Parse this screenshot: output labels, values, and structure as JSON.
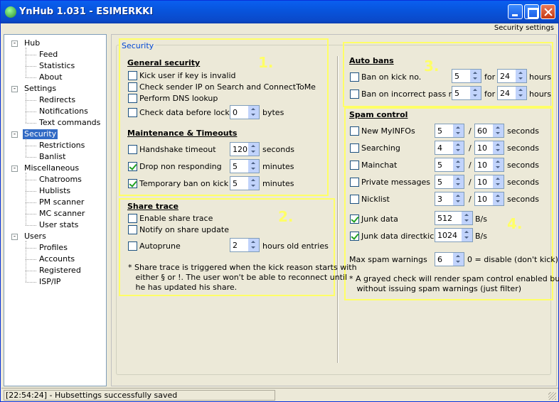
{
  "window": {
    "title": "YnHub 1.031 - ESIMERKKI",
    "header_right": "Security settings"
  },
  "tree": {
    "items": [
      {
        "label": "Hub",
        "level": 0,
        "expander": "-"
      },
      {
        "label": "Feed",
        "level": 1
      },
      {
        "label": "Statistics",
        "level": 1
      },
      {
        "label": "About",
        "level": 1
      },
      {
        "label": "Settings",
        "level": 0,
        "expander": "-"
      },
      {
        "label": "Redirects",
        "level": 1
      },
      {
        "label": "Notifications",
        "level": 1
      },
      {
        "label": "Text commands",
        "level": 1
      },
      {
        "label": "Security",
        "level": 0,
        "expander": "-",
        "selected": true
      },
      {
        "label": "Restrictions",
        "level": 1
      },
      {
        "label": "Banlist",
        "level": 1
      },
      {
        "label": "Miscellaneous",
        "level": 0,
        "expander": "-"
      },
      {
        "label": "Chatrooms",
        "level": 1
      },
      {
        "label": "Hublists",
        "level": 1
      },
      {
        "label": "PM scanner",
        "level": 1
      },
      {
        "label": "MC scanner",
        "level": 1
      },
      {
        "label": "User stats",
        "level": 1
      },
      {
        "label": "Users",
        "level": 0,
        "expander": "-"
      },
      {
        "label": "Profiles",
        "level": 1
      },
      {
        "label": "Accounts",
        "level": 1
      },
      {
        "label": "Registered",
        "level": 1
      },
      {
        "label": "ISP/IP",
        "level": 1
      }
    ]
  },
  "security": {
    "group_label": "Security",
    "general": {
      "heading": "General security",
      "kick_invalid_key": {
        "label": "Kick user if key is invalid",
        "checked": false
      },
      "check_sender_ip": {
        "label": "Check sender IP on Search and ConnectToMe",
        "checked": false
      },
      "dns_lookup": {
        "label": "Perform DNS lookup",
        "checked": false
      },
      "check_data_before_lock": {
        "label": "Check data before lock",
        "checked": false,
        "value": "0",
        "unit": "bytes"
      }
    },
    "maintenance": {
      "heading": "Maintenance & Timeouts",
      "handshake_timeout": {
        "label": "Handshake timeout",
        "checked": false,
        "value": "120",
        "unit": "seconds"
      },
      "drop_non_responding": {
        "label": "Drop non responding",
        "checked": true,
        "value": "5",
        "unit": "minutes"
      },
      "temp_ban_on_kick": {
        "label": "Temporary ban on kick",
        "checked": true,
        "value": "5",
        "unit": "minutes"
      }
    },
    "share_trace": {
      "heading": "Share trace",
      "enable": {
        "label": "Enable share trace",
        "checked": false
      },
      "notify": {
        "label": "Notify on share update",
        "checked": false
      },
      "autoprune": {
        "label": "Autoprune",
        "checked": false,
        "value": "2",
        "unit": "hours old entries"
      },
      "note": "* Share trace is triggered when the kick reason starts with\n   either § or !. The user won't be able to reconnect until\n   he has updated his share."
    },
    "auto_bans": {
      "heading": "Auto bans",
      "kick_no": {
        "label": "Ban on kick no.",
        "checked": false,
        "value": "5",
        "for": "for",
        "hours_value": "24",
        "unit": "hours"
      },
      "incorrect_pass": {
        "label": "Ban on incorrect pass no.",
        "checked": false,
        "value": "5",
        "for": "for",
        "hours_value": "24",
        "unit": "hours"
      }
    },
    "spam": {
      "heading": "Spam control",
      "rows": [
        {
          "label": "New MyINFOs",
          "checked": false,
          "a": "5",
          "b": "60",
          "unit": "seconds"
        },
        {
          "label": "Searching",
          "checked": false,
          "a": "4",
          "b": "10",
          "unit": "seconds"
        },
        {
          "label": "Mainchat",
          "checked": false,
          "a": "5",
          "b": "10",
          "unit": "seconds"
        },
        {
          "label": "Private messages",
          "checked": false,
          "a": "5",
          "b": "10",
          "unit": "seconds"
        },
        {
          "label": "Nicklist",
          "checked": false,
          "a": "3",
          "b": "10",
          "unit": "seconds"
        }
      ],
      "slash": "/",
      "junk_data": {
        "label": "Junk data",
        "checked": true,
        "value": "512",
        "unit": "B/s"
      },
      "junk_directkick": {
        "label": "Junk data directkick",
        "checked": true,
        "value": "1024",
        "unit": "B/s"
      },
      "max_warnings": {
        "label": "Max spam warnings",
        "value": "6",
        "hint": "0 = disable (don't kick)"
      },
      "note": "* A grayed check will render spam control enabled but\n   without issuing spam warnings (just filter)"
    },
    "annotations": [
      "1.",
      "2.",
      "3.",
      "4."
    ]
  },
  "status": {
    "text": "[22:54:24] - Hubsettings successfully saved"
  }
}
